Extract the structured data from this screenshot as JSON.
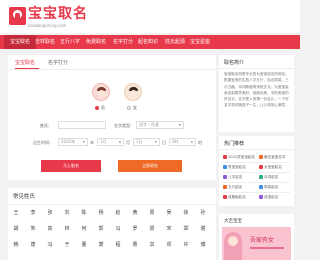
{
  "brand": {
    "title": "宝宝取名",
    "url": "baobaoqiming.com"
  },
  "nav": {
    "items": [
      {
        "label": "宝宝取名",
        "active": true
      },
      {
        "label": "吉祥取名",
        "active": false
      },
      {
        "label": "五行八字",
        "active": false
      },
      {
        "label": "免费取名",
        "active": false
      },
      {
        "label": "名字打分",
        "active": false
      },
      {
        "label": "起名知识",
        "active": false
      },
      {
        "label": "姓氏起源",
        "active": false
      },
      {
        "label": "宝宝星座",
        "active": false
      }
    ]
  },
  "form": {
    "tabs": [
      {
        "label": "宝宝取名",
        "active": true
      },
      {
        "label": "名字打分",
        "active": false
      }
    ],
    "gender": {
      "boy": "男",
      "girl": "女",
      "selected": "boy"
    },
    "surname_label": "姓氏:",
    "surname_placeholder": "",
    "name_type_label": "名字类型:",
    "name_type_value": "双字 - 任意",
    "birth_label": "出生时间:",
    "birth_year": "2022年",
    "birth_month": "1月",
    "birth_day": "1日",
    "birth_hour": "0时",
    "unit_year": "年",
    "unit_month": "月",
    "unit_day": "日",
    "unit_hour": "时",
    "submit_name": "马上取名",
    "submit_test": "立即测名"
  },
  "intro": {
    "title": "取名简介",
    "text": "宝宝取名网是专业的为宝宝起名的网站，根据宝宝的生辰八字五行，结合周易、三才五格、诗词歌赋等传统文化，为宝宝量身定制寓意美好、音韵优美、字形美观的好名字。名字是人的第一张名片，一个好名字将伴随孩子一生，让父母放心满意。"
  },
  "tools": {
    "title": "热门推荐",
    "items": [
      {
        "label": "2022虎宝宝起名",
        "icon": "tiger-icon",
        "color": "#e8394a"
      },
      {
        "label": "最佳宝宝名字",
        "icon": "star-icon",
        "color": "#ef6a26"
      },
      {
        "label": "男宝宝起名",
        "icon": "boy-icon",
        "color": "#3a8ee6"
      },
      {
        "label": "女宝宝起名",
        "icon": "girl-icon",
        "color": "#e8394a"
      },
      {
        "label": "八字起名",
        "icon": "bazi-icon",
        "color": "#8e5bd8"
      },
      {
        "label": "诗词起名",
        "icon": "poem-icon",
        "color": "#2bb07a"
      },
      {
        "label": "五行起名",
        "icon": "wuxing-icon",
        "color": "#ef6a26"
      },
      {
        "label": "周易起名",
        "icon": "zhouyi-icon",
        "color": "#3a8ee6"
      },
      {
        "label": "双胞胎起名",
        "icon": "twins-icon",
        "color": "#e8394a"
      },
      {
        "label": "成语起名",
        "icon": "idiom-icon",
        "color": "#8e5bd8"
      }
    ]
  },
  "surnames": {
    "title": "常见姓氏",
    "rows": [
      [
        "王",
        "李",
        "张",
        "刘",
        "陈",
        "杨",
        "赵",
        "黄",
        "周",
        "吴",
        "徐",
        "孙"
      ],
      [
        "胡",
        "朱",
        "高",
        "林",
        "何",
        "郭",
        "马",
        "罗",
        "梁",
        "宋",
        "郑",
        "谢"
      ],
      [
        "韩",
        "唐",
        "冯",
        "于",
        "董",
        "萧",
        "程",
        "曹",
        "袁",
        "邓",
        "许",
        "傅"
      ]
    ]
  },
  "promo": {
    "title": "大吉宝宝",
    "banner_text": "吾家有女"
  }
}
